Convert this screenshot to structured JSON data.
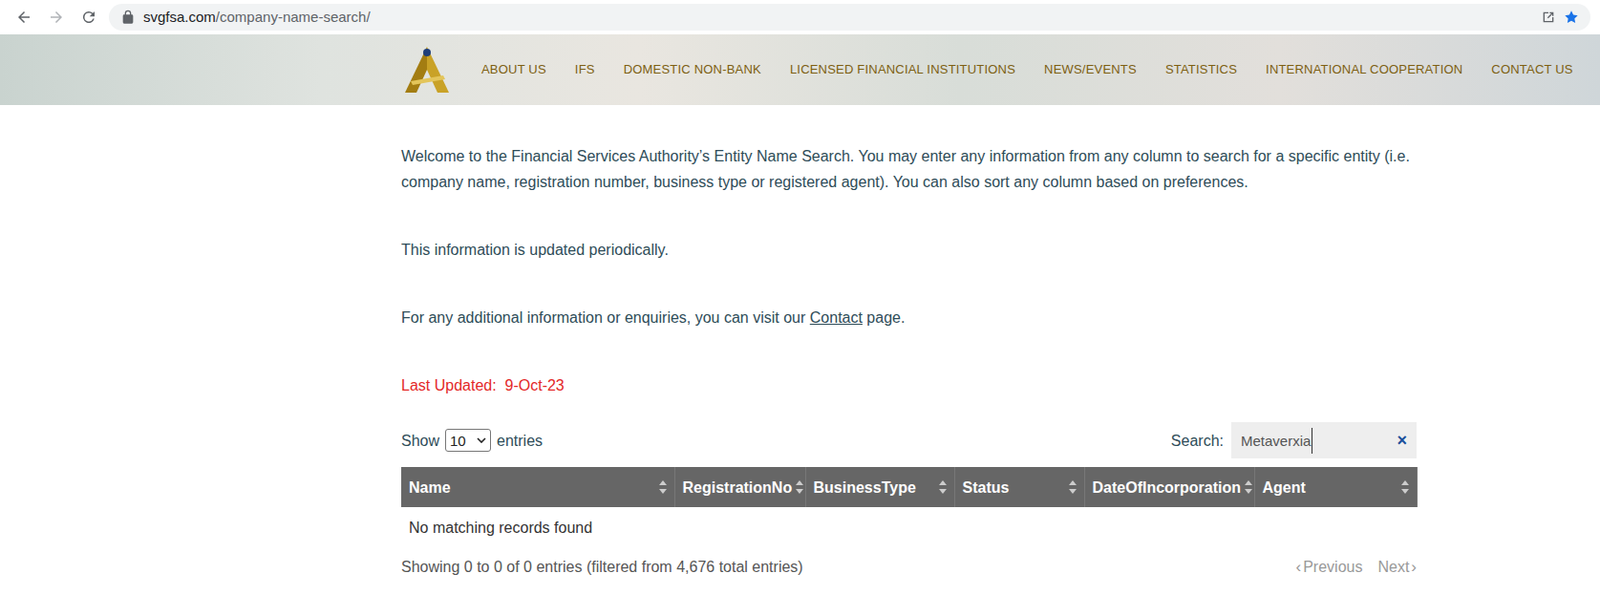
{
  "browser": {
    "url_host": "svgfsa.com",
    "url_path": "/company-name-search/"
  },
  "nav": {
    "items": [
      "ABOUT US",
      "IFS",
      "DOMESTIC NON-BANK",
      "LICENSED FINANCIAL INSTITUTIONS",
      "NEWS/EVENTS",
      "STATISTICS",
      "INTERNATIONAL COOPERATION",
      "CONTACT US"
    ]
  },
  "intro": [
    "Welcome to the Financial Services Authority’s Entity Name Search. You may enter any information from any column to search for a specific entity (i.e. company name, registration number, business type or registered agent). You can also sort any column based on preferences.",
    "This information is updated periodically."
  ],
  "contact": {
    "before": "For any additional information or enquiries, you can visit our ",
    "link": "Contact",
    "after": " page."
  },
  "last_updated": "Last Updated:  9-Oct-23",
  "length": {
    "prefix": "Show",
    "value": "10",
    "suffix": "entries"
  },
  "search": {
    "label": "Search:",
    "value": "Metaverxia",
    "clear": "×"
  },
  "table": {
    "columns": [
      "Name",
      "RegistrationNo",
      "BusinessType",
      "Status",
      "DateOfIncorporation",
      "Agent"
    ],
    "empty": "No matching records found"
  },
  "info": "Showing 0 to 0 of 0 entries (filtered from 4,676 total entries)",
  "pagination": [
    {
      "label": "Previous",
      "arrow": "‹",
      "kind": "prev",
      "disabled": true
    },
    {
      "label": "Next",
      "arrow": "›",
      "kind": "next",
      "disabled": true
    }
  ]
}
